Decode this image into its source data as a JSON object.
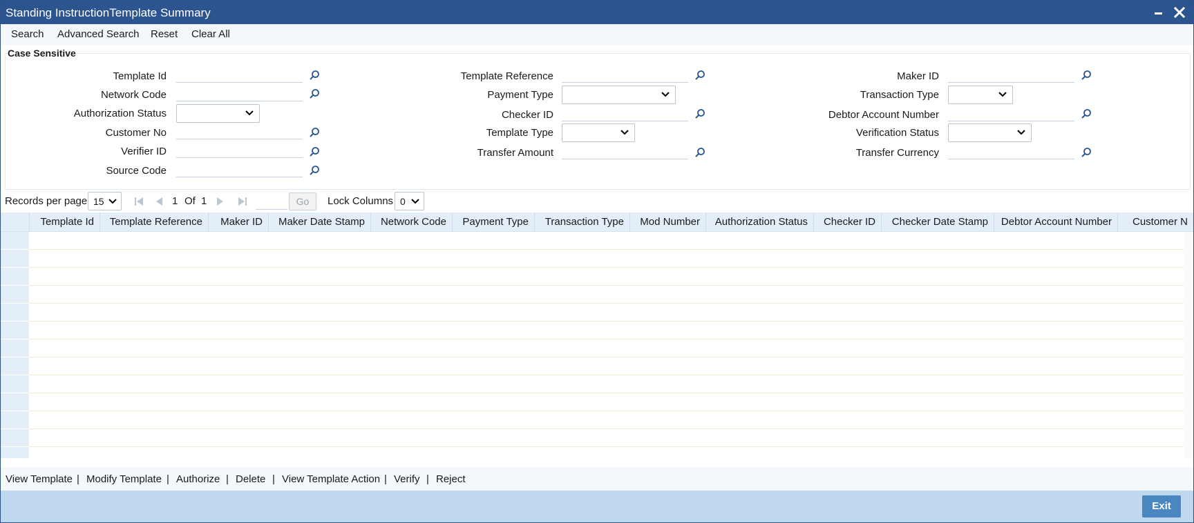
{
  "window": {
    "title": "Standing InstructionTemplate Summary"
  },
  "toolbar": {
    "search": "Search",
    "advanced_search": "Advanced Search",
    "reset": "Reset",
    "clear_all": "Clear All"
  },
  "criteria": {
    "legend": "Case Sensitive",
    "col1": {
      "template_id": "Template Id",
      "network_code": "Network Code",
      "authorization_status": "Authorization Status",
      "customer_no": "Customer No",
      "verifier_id": "Verifier ID",
      "source_code": "Source Code"
    },
    "col2": {
      "template_reference": "Template Reference",
      "payment_type": "Payment Type",
      "checker_id": "Checker ID",
      "template_type": "Template Type",
      "transfer_amount": "Transfer Amount"
    },
    "col3": {
      "maker_id": "Maker ID",
      "transaction_type": "Transaction Type",
      "debtor_account_number": "Debtor Account Number",
      "verification_status": "Verification Status",
      "transfer_currency": "Transfer Currency"
    }
  },
  "pager": {
    "records_label": "Records per page",
    "records_value": "15",
    "current_page": "1",
    "of_label": "Of",
    "total_pages": "1",
    "go_label": "Go",
    "lock_label": "Lock Columns",
    "lock_value": "0"
  },
  "grid": {
    "columns": [
      "Template Id",
      "Template Reference",
      "Maker ID",
      "Maker Date Stamp",
      "Network Code",
      "Payment Type",
      "Transaction Type",
      "Mod Number",
      "Authorization Status",
      "Checker ID",
      "Checker Date Stamp",
      "Debtor Account Number",
      "Customer N"
    ]
  },
  "actions": {
    "view_template": "View Template",
    "modify_template": "Modify Template",
    "authorize": "Authorize",
    "delete": "Delete",
    "view_template_action": "View Template Action",
    "verify": "Verify",
    "reject": "Reject",
    "separator": "|"
  },
  "footer": {
    "exit": "Exit"
  },
  "colors": {
    "titlebar": "#2c5590",
    "header_bg": "#e4eef8",
    "footer_bg": "#c0d8ed",
    "exit_button": "#4a86c0"
  },
  "icons": {
    "field_search": "search-icon",
    "select_toggle": "chevron-down-icon",
    "first_page": "first-page-icon",
    "prev_page": "prev-page-icon",
    "next_page": "next-page-icon",
    "last_page": "last-page-icon",
    "minimize": "minimize-icon",
    "close": "close-icon"
  }
}
